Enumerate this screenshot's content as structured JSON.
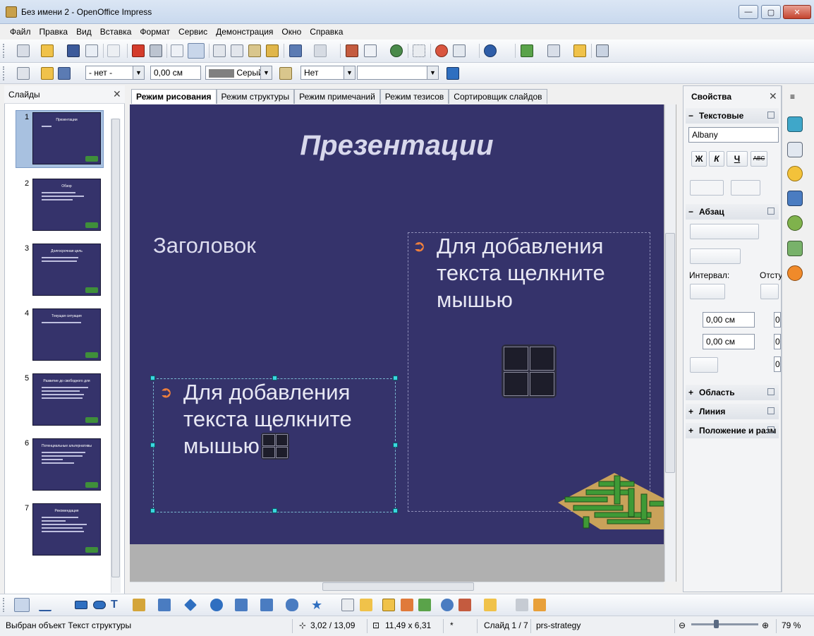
{
  "window": {
    "title": "Без имени 2 - OpenOffice Impress",
    "min_glyph": "—",
    "max_glyph": "▢",
    "close_glyph": "✕"
  },
  "menu": [
    "Файл",
    "Правка",
    "Вид",
    "Вставка",
    "Формат",
    "Сервис",
    "Демонстрация",
    "Окно",
    "Справка"
  ],
  "toolbar2": {
    "line_style": "- нет -",
    "line_width": "0,00 см",
    "line_color": "Серый",
    "area_style": "Нет",
    "area_fill": ""
  },
  "slides_pane": {
    "title": "Слайды",
    "close": "✕",
    "slides": [
      {
        "num": "1",
        "title": "Презентации"
      },
      {
        "num": "2",
        "title": "Обзор"
      },
      {
        "num": "3",
        "title": "Долгосрочная цель"
      },
      {
        "num": "4",
        "title": "Текущая ситуация"
      },
      {
        "num": "5",
        "title": "Развитие до свободного для"
      },
      {
        "num": "6",
        "title": "Потенциальные альтернативы"
      },
      {
        "num": "7",
        "title": "Рекомендация"
      }
    ]
  },
  "tabs": [
    "Режим рисования",
    "Режим структуры",
    "Режим примечаний",
    "Режим тезисов",
    "Сортировщик слайдов"
  ],
  "slide": {
    "title": "Презентации",
    "heading": "Заголовок",
    "placeholder_text": "Для добавления текста щелкните мышью",
    "placeholder_lines": [
      "Для добавления",
      "текста щелкните",
      "мышью"
    ],
    "bullet": "➲"
  },
  "sidebar": {
    "title": "Свойства",
    "close": "✕",
    "text_section": "Текстовые",
    "font": "Albany",
    "bold": "Ж",
    "italic": "К",
    "underline": "Ч",
    "strike": "ABC",
    "para_section": "Абзац",
    "spacing_label": "Интервал:",
    "indent_label": "Отсту",
    "spacing_above": "0,00 см",
    "spacing_below": "0,00 см",
    "indent_value": "0",
    "area_section": "Область",
    "line_section": "Линия",
    "position_section": "Положение и разм"
  },
  "status": {
    "selection": "Выбран объект Текст структуры",
    "position": "3,02 / 13,09",
    "size": "11,49 x 6,31",
    "modified": "*",
    "slide": "Слайд 1 / 7",
    "master": "prs-strategy",
    "zoom": "79 %"
  },
  "colors": {
    "slide_bg": "#35336b",
    "bullet": "#f0803c",
    "selection_handles": "#3ad7e0"
  }
}
